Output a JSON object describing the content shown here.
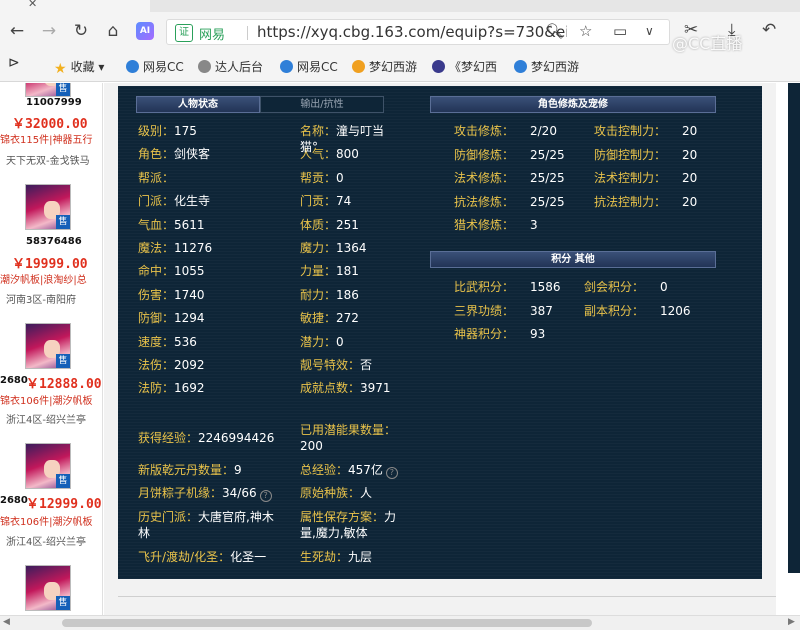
{
  "browser": {
    "url": "https://xyq.cbg.163.com/equip?s=730&ei",
    "verify_label": "网易",
    "ai_label": "AI",
    "watermark": "@CC直播"
  },
  "bookmarks": [
    {
      "label": "收藏",
      "color": "#f2b01e"
    },
    {
      "label": "网易CC",
      "color": "#2f7fd8"
    },
    {
      "label": "达人后台",
      "color": "#888888"
    },
    {
      "label": "网易CC",
      "color": "#2f7fd8"
    },
    {
      "label": "梦幻西游",
      "color": "#f0a020"
    },
    {
      "label": "《梦幻西",
      "color": "#3a3a8c"
    },
    {
      "label": "梦幻西游",
      "color": "#2f7fd8"
    }
  ],
  "listing": {
    "top_id": "11007999",
    "items": [
      {
        "price": "￥32000.00",
        "red": "锦衣115件|神器五行",
        "server": "天下无双-金戈铁马",
        "id": "58376486"
      },
      {
        "price": "￥19999.00",
        "red": "潮汐帆板|浪淘纱|总",
        "server": "河南3区-南阳府",
        "id": ""
      },
      {
        "price": "￥12888.00",
        "red": "锦衣106件|潮汐帆板",
        "server": "浙江4区-绍兴兰亭",
        "id": "2680"
      },
      {
        "price": "￥12999.00",
        "red": "锦衣106件|潮汐帆板",
        "server": "浙江4区-绍兴兰亭",
        "id": "2680"
      }
    ],
    "sell_badge": "售"
  },
  "char": {
    "tab_active": "人物状态",
    "tab_inactive": "输出/抗性",
    "left": [
      {
        "l": "级别：",
        "v": "175"
      },
      {
        "l": "角色：",
        "v": "剑侠客"
      },
      {
        "l": "帮派：",
        "v": ""
      },
      {
        "l": "门派：",
        "v": "化生寺"
      },
      {
        "l": "气血：",
        "v": "5611"
      },
      {
        "l": "魔法：",
        "v": "11276"
      },
      {
        "l": "命中：",
        "v": "1055"
      },
      {
        "l": "伤害：",
        "v": "1740"
      },
      {
        "l": "防御：",
        "v": "1294"
      },
      {
        "l": "速度：",
        "v": "536"
      },
      {
        "l": "法伤：",
        "v": "2092"
      },
      {
        "l": "法防：",
        "v": "1692"
      }
    ],
    "right": [
      {
        "l": "名称：",
        "v": "潼与叮当"
      },
      {
        "l": "人气：",
        "v": "800"
      },
      {
        "l": "帮贡：",
        "v": "0"
      },
      {
        "l": "门贡：",
        "v": "74"
      },
      {
        "l": "体质：",
        "v": "251"
      },
      {
        "l": "魔力：",
        "v": "1364"
      },
      {
        "l": "力量：",
        "v": "181"
      },
      {
        "l": "耐力：",
        "v": "186"
      },
      {
        "l": "敏捷：",
        "v": "272"
      },
      {
        "l": "潜力：",
        "v": "0"
      },
      {
        "l": "靓号特效：",
        "v": "否"
      },
      {
        "l": "成就点数：",
        "v": "3971"
      }
    ],
    "name_cont": "猫°",
    "exp_label": "获得经验：",
    "exp_value": "2246994426",
    "potential_label": "已用潜能果数量：",
    "potential_value": "200",
    "qy_label": "新版乾元丹数量：",
    "qy_value": "9",
    "total_exp_label": "总经验：",
    "total_exp_value": "457亿",
    "moon_label": "月饼粽子机缘：",
    "moon_value": "34/66",
    "race_label": "原始种族：",
    "race_value": "人",
    "history_label": "历史门派：",
    "history_value": "大唐官府,神木",
    "history_value2": "林",
    "attr_label": "属性保存方案：",
    "attr_value": "力",
    "attr_value2": "量,魔力,敏体",
    "fly_label": "飞升/渡劫/化圣：",
    "fly_value": "化圣一",
    "death_label": "生死劫：",
    "death_value": "九层"
  },
  "cultivation": {
    "header": "角色修炼及宠修",
    "left": [
      {
        "l": "攻击修炼：",
        "v": "2/20"
      },
      {
        "l": "防御修炼：",
        "v": "25/25"
      },
      {
        "l": "法术修炼：",
        "v": "25/25"
      },
      {
        "l": "抗法修炼：",
        "v": "25/25"
      },
      {
        "l": "猎术修炼：",
        "v": "3"
      }
    ],
    "right": [
      {
        "l": "攻击控制力：",
        "v": "20"
      },
      {
        "l": "防御控制力：",
        "v": "20"
      },
      {
        "l": "法术控制力：",
        "v": "20"
      },
      {
        "l": "抗法控制力：",
        "v": "20"
      }
    ]
  },
  "scores": {
    "header": "积分 其他",
    "rows": [
      {
        "l": "比武积分：",
        "v": "1586",
        "l2": "剑会积分：",
        "v2": "0"
      },
      {
        "l": "三界功绩：",
        "v": "387",
        "l2": "副本积分：",
        "v2": "1206"
      },
      {
        "l": "神器积分：",
        "v": "93",
        "l2": "",
        "v2": ""
      }
    ]
  }
}
